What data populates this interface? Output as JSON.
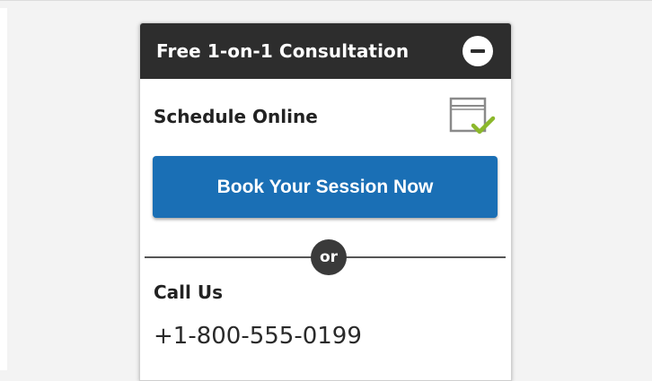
{
  "panel": {
    "title": "Free 1-on-1 Consultation",
    "collapse_icon": "minus-circle-icon"
  },
  "schedule": {
    "label": "Schedule Online",
    "icon": "calendar-check-icon",
    "button_label": "Book Your Session Now"
  },
  "divider": {
    "label": "or"
  },
  "call": {
    "label": "Call Us",
    "phone": "+1-800-555-0199"
  },
  "colors": {
    "header_bg": "#2d2d2d",
    "button_bg": "#1a6fb5",
    "check": "#8cb82b"
  }
}
